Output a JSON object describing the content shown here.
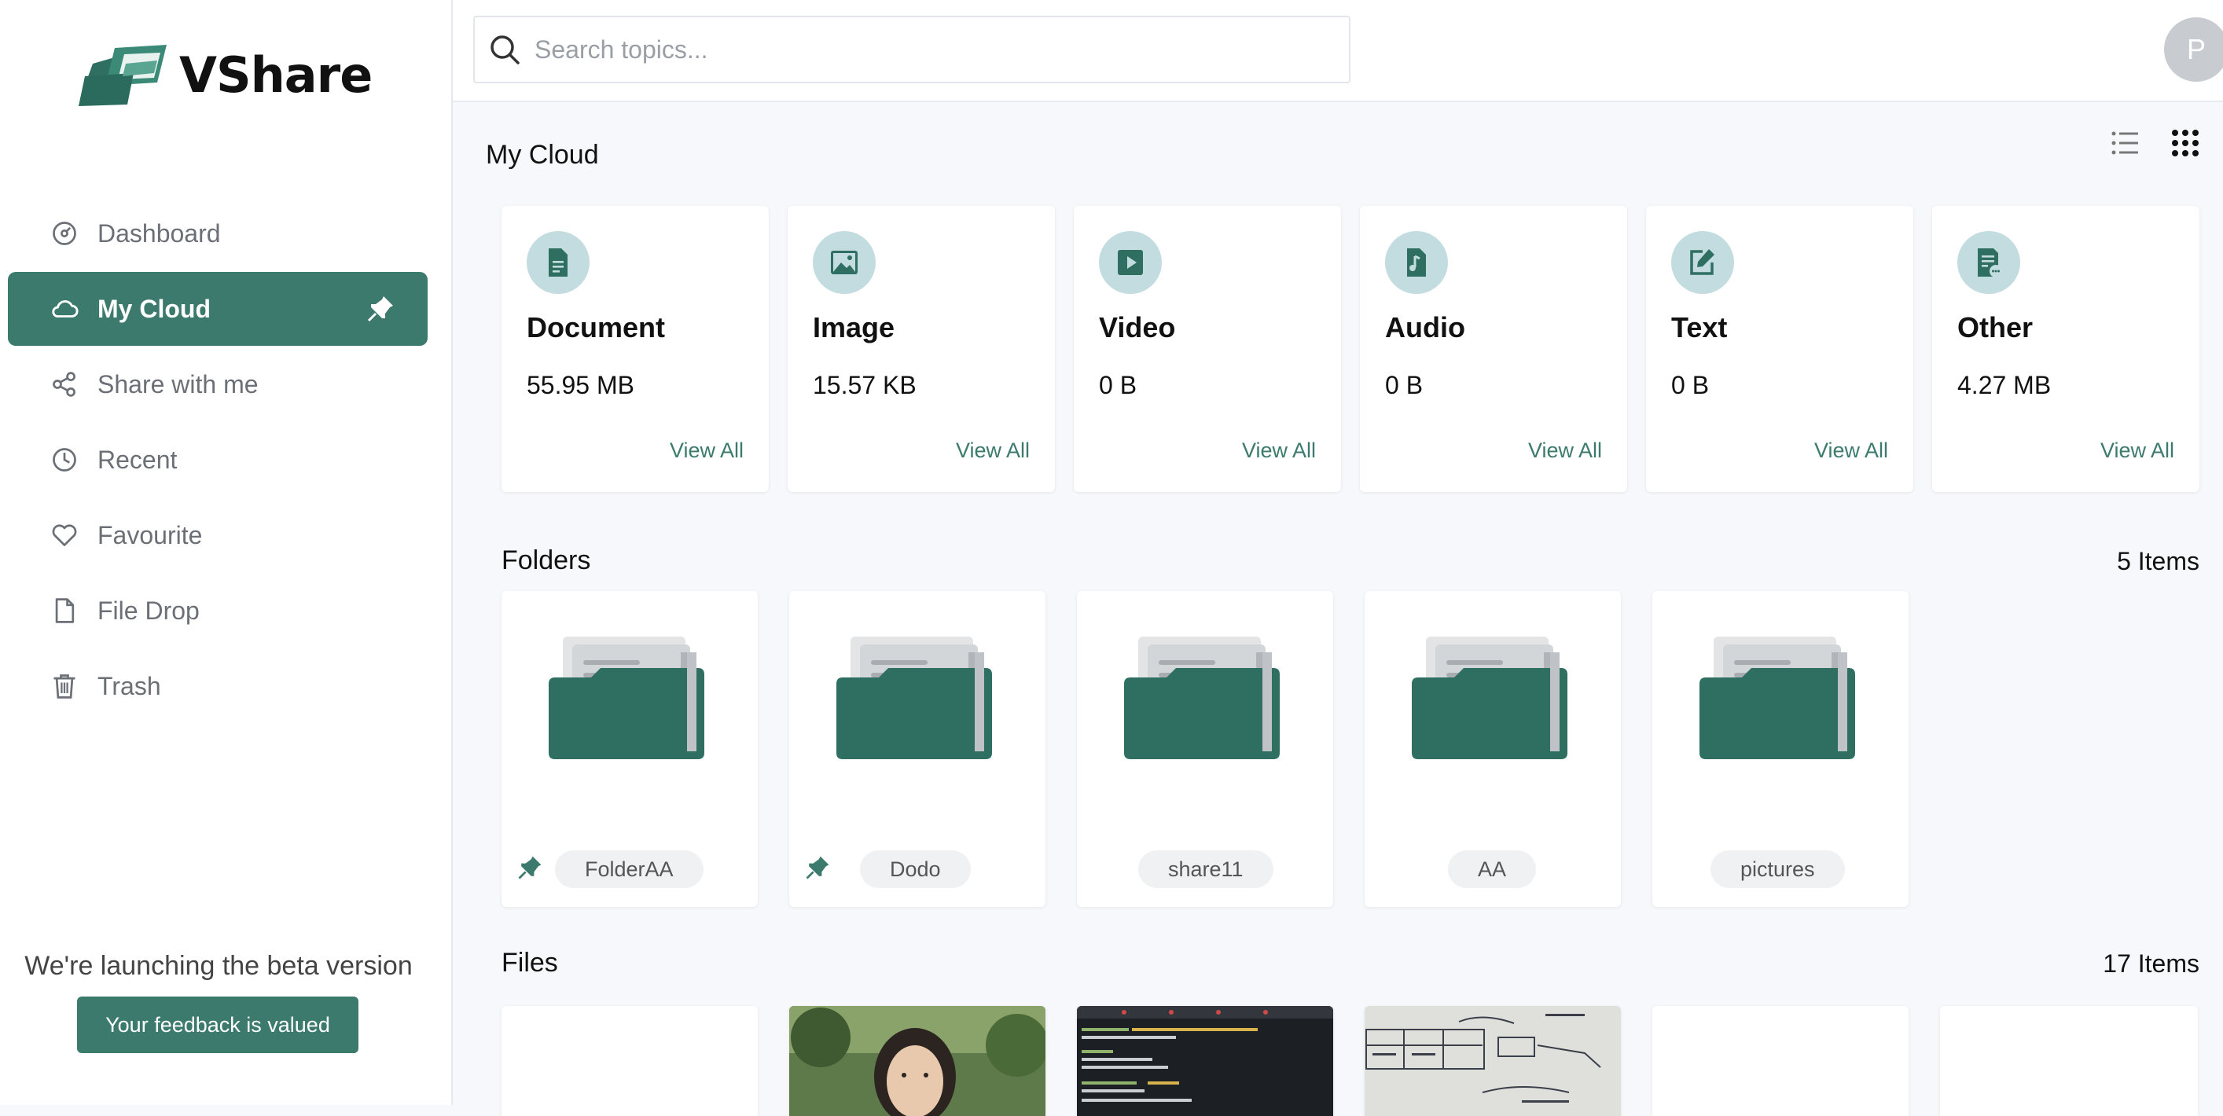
{
  "app": {
    "name": "VShare"
  },
  "sidebar": {
    "items": [
      {
        "label": "Dashboard",
        "icon": "dashboard-icon"
      },
      {
        "label": "My Cloud",
        "icon": "cloud-icon",
        "active": true,
        "pinned": true
      },
      {
        "label": "Share with me",
        "icon": "share-icon"
      },
      {
        "label": "Recent",
        "icon": "clock-icon"
      },
      {
        "label": "Favourite",
        "icon": "heart-icon"
      },
      {
        "label": "File Drop",
        "icon": "file-icon"
      },
      {
        "label": "Trash",
        "icon": "trash-icon"
      }
    ],
    "beta_text": "We're launching the beta version",
    "feedback_label": "Your feedback is valued"
  },
  "header": {
    "search_placeholder": "Search topics...",
    "avatar_initial": "P"
  },
  "main": {
    "title": "My Cloud",
    "categories": [
      {
        "name": "Document",
        "size": "55.95 MB",
        "action": "View All",
        "icon": "document-icon"
      },
      {
        "name": "Image",
        "size": "15.57 KB",
        "action": "View All",
        "icon": "image-icon"
      },
      {
        "name": "Video",
        "size": "0 B",
        "action": "View All",
        "icon": "video-icon"
      },
      {
        "name": "Audio",
        "size": "0 B",
        "action": "View All",
        "icon": "audio-icon"
      },
      {
        "name": "Text",
        "size": "0 B",
        "action": "View All",
        "icon": "edit-icon"
      },
      {
        "name": "Other",
        "size": "4.27 MB",
        "action": "View All",
        "icon": "other-file-icon"
      }
    ],
    "folders": {
      "title": "Folders",
      "count": "5 Items",
      "items": [
        {
          "name": "FolderAA",
          "pinned": true
        },
        {
          "name": "Dodo",
          "pinned": true
        },
        {
          "name": "share11",
          "pinned": false
        },
        {
          "name": "AA",
          "pinned": false
        },
        {
          "name": "pictures",
          "pinned": false
        }
      ]
    },
    "files": {
      "title": "Files",
      "count": "17 Items"
    }
  },
  "colors": {
    "accent": "#3b7a6c",
    "badge_bg": "#c3dcdf",
    "background": "#f6f8fb"
  }
}
